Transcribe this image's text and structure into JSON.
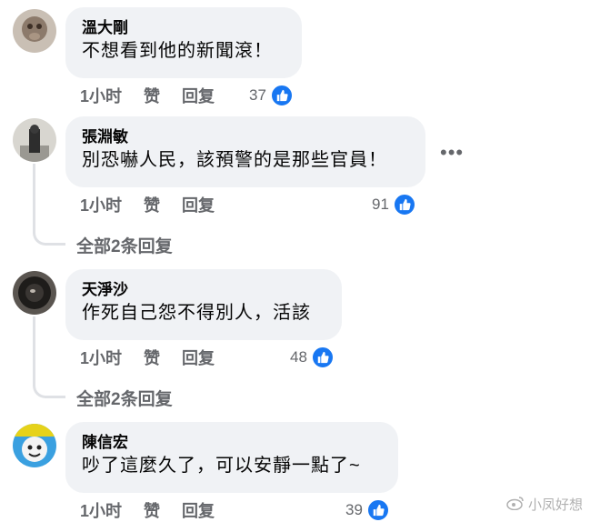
{
  "comments": [
    {
      "author": "溫大剛",
      "text": "不想看到他的新聞滾！",
      "time": "1小时",
      "like_label": "赞",
      "reply_label": "回复",
      "likes": "37",
      "view_replies": ""
    },
    {
      "author": "張淵敏",
      "text": "別恐嚇人民，該預警的是那些官員！",
      "time": "1小时",
      "like_label": "赞",
      "reply_label": "回复",
      "likes": "91",
      "view_replies": "全部2条回复"
    },
    {
      "author": "天淨沙",
      "text": "作死自己怨不得別人，活該",
      "time": "1小时",
      "like_label": "赞",
      "reply_label": "回复",
      "likes": "48",
      "view_replies": "全部2条回复"
    },
    {
      "author": "陳信宏",
      "text": "吵了這麼久了，可以安靜一點了~",
      "time": "1小时",
      "like_label": "赞",
      "reply_label": "回复",
      "likes": "39",
      "view_replies": ""
    }
  ],
  "watermark": "小凤好想",
  "colors": {
    "bubble": "#f0f2f5",
    "like_blue": "#1877f2",
    "meta_gray": "#65676b"
  }
}
